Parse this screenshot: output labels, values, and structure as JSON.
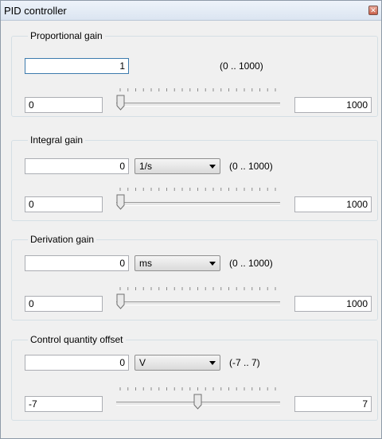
{
  "window": {
    "title": "PID controller"
  },
  "groups": [
    {
      "title": "Proportional gain",
      "value": "1",
      "unit": null,
      "range": "(0 .. 1000)",
      "min": "0",
      "max": "1000",
      "slider_fraction": 0.0
    },
    {
      "title": "Integral gain",
      "value": "0",
      "unit": "1/s",
      "range": "(0 .. 1000)",
      "min": "0",
      "max": "1000",
      "slider_fraction": 0.0
    },
    {
      "title": "Derivation gain",
      "value": "0",
      "unit": "ms",
      "range": "(0 .. 1000)",
      "min": "0",
      "max": "1000",
      "slider_fraction": 0.0
    },
    {
      "title": "Control quantity offset",
      "value": "0",
      "unit": "V",
      "range": "(-7 .. 7)",
      "min": "-7",
      "max": "7",
      "slider_fraction": 0.5
    }
  ],
  "icons": {
    "close": "close-icon",
    "dropdown": "chevron-down-icon"
  }
}
